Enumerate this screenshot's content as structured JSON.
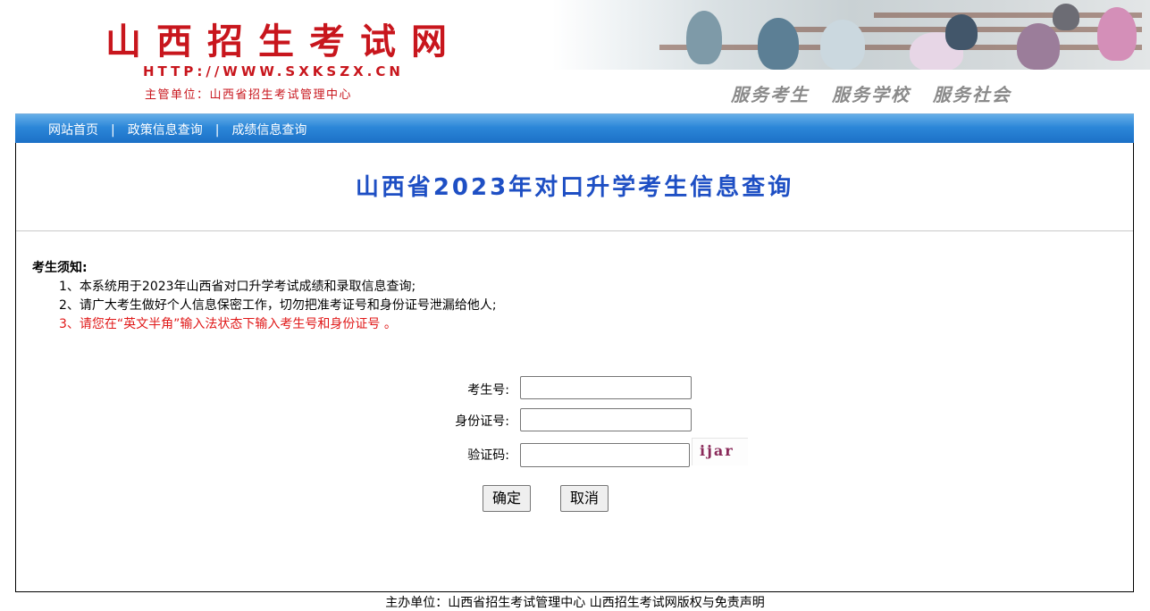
{
  "header": {
    "site_title": "山西招生考试网",
    "site_url": "HTTP://WWW.SXKSZX.CN",
    "organizer": "主管单位：山西省招生考试管理中心",
    "slogan": "服务考生 服务学校 服务社会"
  },
  "nav": {
    "items": [
      {
        "label": "网站首页"
      },
      {
        "label": "政策信息查询"
      },
      {
        "label": "成绩信息查询"
      }
    ],
    "separator": "|"
  },
  "page": {
    "title": "山西省2023年对口升学考生信息查询"
  },
  "notice": {
    "heading": "考生须知:",
    "items": [
      "1、本系统用于2023年山西省对口升学考试成绩和录取信息查询;",
      "2、请广大考生做好个人信息保密工作，切勿把准考证号和身份证号泄漏给他人;",
      "3、请您在“英文半角”输入法状态下输入考生号和身份证号 。"
    ]
  },
  "form": {
    "exam_no_label": "考生号:",
    "exam_no_value": "",
    "id_no_label": "身份证号:",
    "id_no_value": "",
    "captcha_label": "验证码:",
    "captcha_value": "",
    "captcha_image_text": "ijar",
    "submit_label": "确定",
    "cancel_label": "取消"
  },
  "footer": {
    "text": "主办单位：山西省招生考试管理中心 山西招生考试网版权与免责声明"
  },
  "colors": {
    "brand_red": "#c8161d",
    "title_blue": "#1e4fc4",
    "nav_blue": "#2b86d8",
    "notice_red": "#e01818"
  }
}
